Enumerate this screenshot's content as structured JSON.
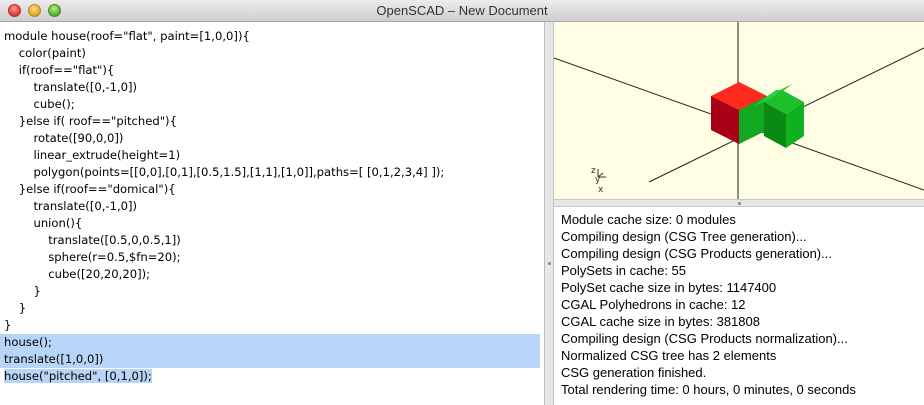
{
  "window": {
    "title": "OpenSCAD – New Document"
  },
  "editor": {
    "lines": [
      "module house(roof=\"flat\", paint=[1,0,0]){",
      "    color(paint)",
      "    if(roof==\"flat\"){",
      "        translate([0,-1,0])",
      "        cube();",
      "    }else if( roof==\"pitched\"){",
      "        rotate([90,0,0])",
      "        linear_extrude(height=1)",
      "        polygon(points=[[0,0],[0,1],[0.5,1.5],[1,1],[1,0]],paths=[ [0,1,2,3,4] ]);",
      "    }else if(roof==\"domical\"){",
      "        translate([0,-1,0])",
      "        union(){",
      "            translate([0.5,0,0.5,1])",
      "            sphere(r=0.5,$fn=20);",
      "            cube([20,20,20]);",
      "        }",
      "    }",
      "}",
      "house();",
      "translate([1,0,0])",
      "house(\"pitched\", [0,1,0]);"
    ]
  },
  "viewport": {
    "axis_labels": {
      "z": "z",
      "y": "y",
      "x": "x"
    },
    "colors": {
      "background": "#fffde3",
      "red_cube_top": "#ff2a1e",
      "red_cube_front": "#c0001a",
      "red_cube_side": "#8a0010",
      "green_house_top": "#2ad03a",
      "green_house_front": "#10b020",
      "green_house_side": "#0a8a14"
    }
  },
  "console": {
    "lines": [
      "Module cache size: 0 modules",
      "Compiling design (CSG Tree generation)...",
      "Compiling design (CSG Products generation)...",
      "PolySets in cache: 55",
      "PolySet cache size in bytes: 1147400",
      "CGAL Polyhedrons in cache: 12",
      "CGAL cache size in bytes: 381808",
      "Compiling design (CSG Products normalization)...",
      "Normalized CSG tree has 2 elements",
      "CSG generation finished.",
      "Total rendering time: 0 hours, 0 minutes, 0 seconds"
    ]
  }
}
